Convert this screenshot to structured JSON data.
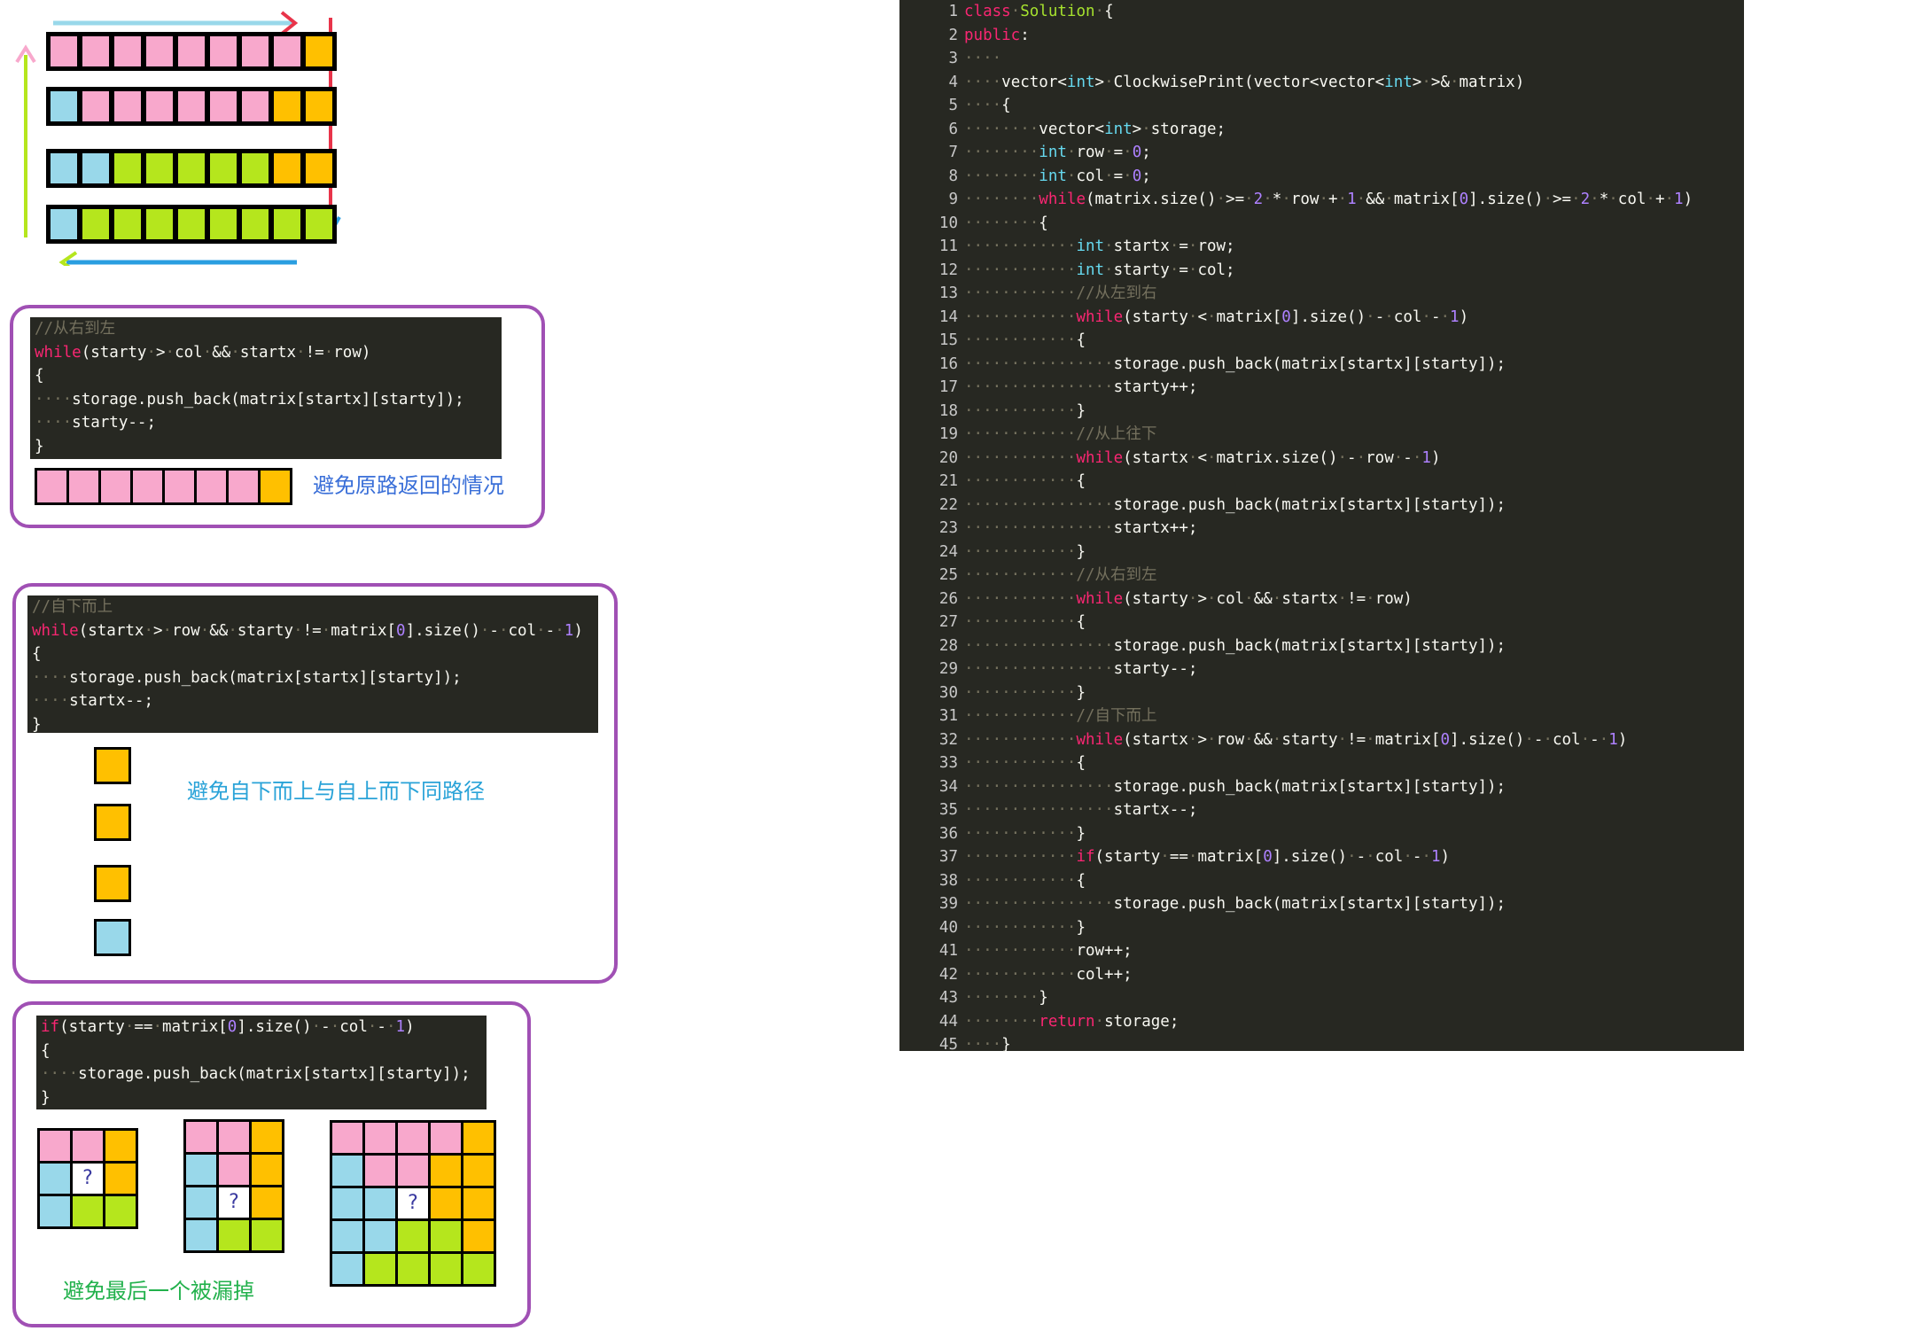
{
  "colors": {
    "pink": "#f8a8cc",
    "yellow": "#ffc000",
    "blue": "#99d8ea",
    "green": "#b5e61d",
    "box_border": "#a050b4",
    "code_bg": "#272822"
  },
  "main_code": {
    "lines": [
      "class Solution {",
      "public:",
      "    ",
      "    vector<int> ClockwisePrint(vector<vector<int> >& matrix)",
      "    {",
      "        vector<int> storage;",
      "        int row = 0;",
      "        int col = 0;",
      "        while(matrix.size() >= 2 * row + 1 && matrix[0].size() >= 2 * col + 1)",
      "        {",
      "            int startx = row;",
      "            int starty = col;",
      "            //从左到右",
      "            while(starty < matrix[0].size() - col - 1)",
      "            {",
      "                storage.push_back(matrix[startx][starty]);",
      "                starty++;",
      "            }",
      "            //从上往下",
      "            while(startx < matrix.size() - row - 1)",
      "            {",
      "                storage.push_back(matrix[startx][starty]);",
      "                startx++;",
      "            }",
      "            //从右到左",
      "            while(starty > col && startx != row)",
      "            {",
      "                storage.push_back(matrix[startx][starty]);",
      "                starty--;",
      "            }",
      "            //自下而上",
      "            while(startx > row && starty != matrix[0].size() - col - 1)",
      "            {",
      "                storage.push_back(matrix[startx][starty]);",
      "                startx--;",
      "            }",
      "            if(starty == matrix[0].size() - col - 1)",
      "            {",
      "                storage.push_back(matrix[startx][starty]);",
      "            }",
      "            row++;",
      "            col++;",
      "        }",
      "        return storage;",
      "    }"
    ]
  },
  "snippet1": {
    "lines": [
      "//从右到左",
      "while(starty > col && startx != row)",
      "{",
      "    storage.push_back(matrix[startx][starty]);",
      "    starty--;",
      "}"
    ],
    "caption": "避免原路返回的情况",
    "caption_color": "#3a6fd8",
    "row_cells": [
      "pink",
      "pink",
      "pink",
      "pink",
      "pink",
      "pink",
      "pink",
      "yellow"
    ]
  },
  "snippet2": {
    "lines": [
      "//自下而上",
      "while(startx > row && starty != matrix[0].size() - col - 1)",
      "{",
      "    storage.push_back(matrix[startx][starty]);",
      "    startx--;",
      "}"
    ],
    "caption": "避免自下而上与自上而下同路径",
    "caption_color": "#2aa3d8",
    "column_cells": [
      "yellow",
      "yellow",
      "yellow",
      "blue"
    ]
  },
  "snippet3": {
    "lines": [
      "if(starty == matrix[0].size() - col - 1)",
      "{",
      "    storage.push_back(matrix[startx][starty]);",
      "}"
    ],
    "caption": "避免最后一个被漏掉",
    "caption_color": "#22b14c",
    "question_mark": "?",
    "grid_3x3": [
      [
        "pink",
        "pink",
        "yellow"
      ],
      [
        "blue",
        "q",
        "yellow"
      ],
      [
        "blue",
        "green",
        "green"
      ]
    ],
    "grid_4x3": [
      [
        "pink",
        "pink",
        "yellow"
      ],
      [
        "blue",
        "pink",
        "yellow"
      ],
      [
        "blue",
        "q",
        "yellow"
      ],
      [
        "blue",
        "green",
        "green"
      ]
    ],
    "grid_5x5": [
      [
        "pink",
        "pink",
        "pink",
        "pink",
        "yellow"
      ],
      [
        "blue",
        "pink",
        "pink",
        "yellow",
        "yellow"
      ],
      [
        "blue",
        "blue",
        "q",
        "yellow",
        "yellow"
      ],
      [
        "blue",
        "blue",
        "green",
        "green",
        "yellow"
      ],
      [
        "blue",
        "green",
        "green",
        "green",
        "green"
      ]
    ]
  },
  "top_diagram": {
    "rows": [
      [
        "pink",
        "pink",
        "pink",
        "pink",
        "pink",
        "pink",
        "pink",
        "pink",
        "yellow"
      ],
      [
        "blue",
        "pink",
        "pink",
        "pink",
        "pink",
        "pink",
        "pink",
        "yellow",
        "yellow"
      ],
      [
        "blue",
        "blue",
        "green",
        "green",
        "green",
        "green",
        "green",
        "yellow",
        "yellow"
      ],
      [
        "blue",
        "green",
        "green",
        "green",
        "green",
        "green",
        "green",
        "green",
        "green"
      ]
    ],
    "arrow_colors": {
      "top": "#99d8ea",
      "top_head": "#e8344a",
      "right": "#e8344a",
      "right_head": "#2a9ee0",
      "bottom": "#2a9ee0",
      "bottom_head": "#b5e61d",
      "left": "#b5e61d",
      "left_head": "#f8a8cc"
    }
  }
}
